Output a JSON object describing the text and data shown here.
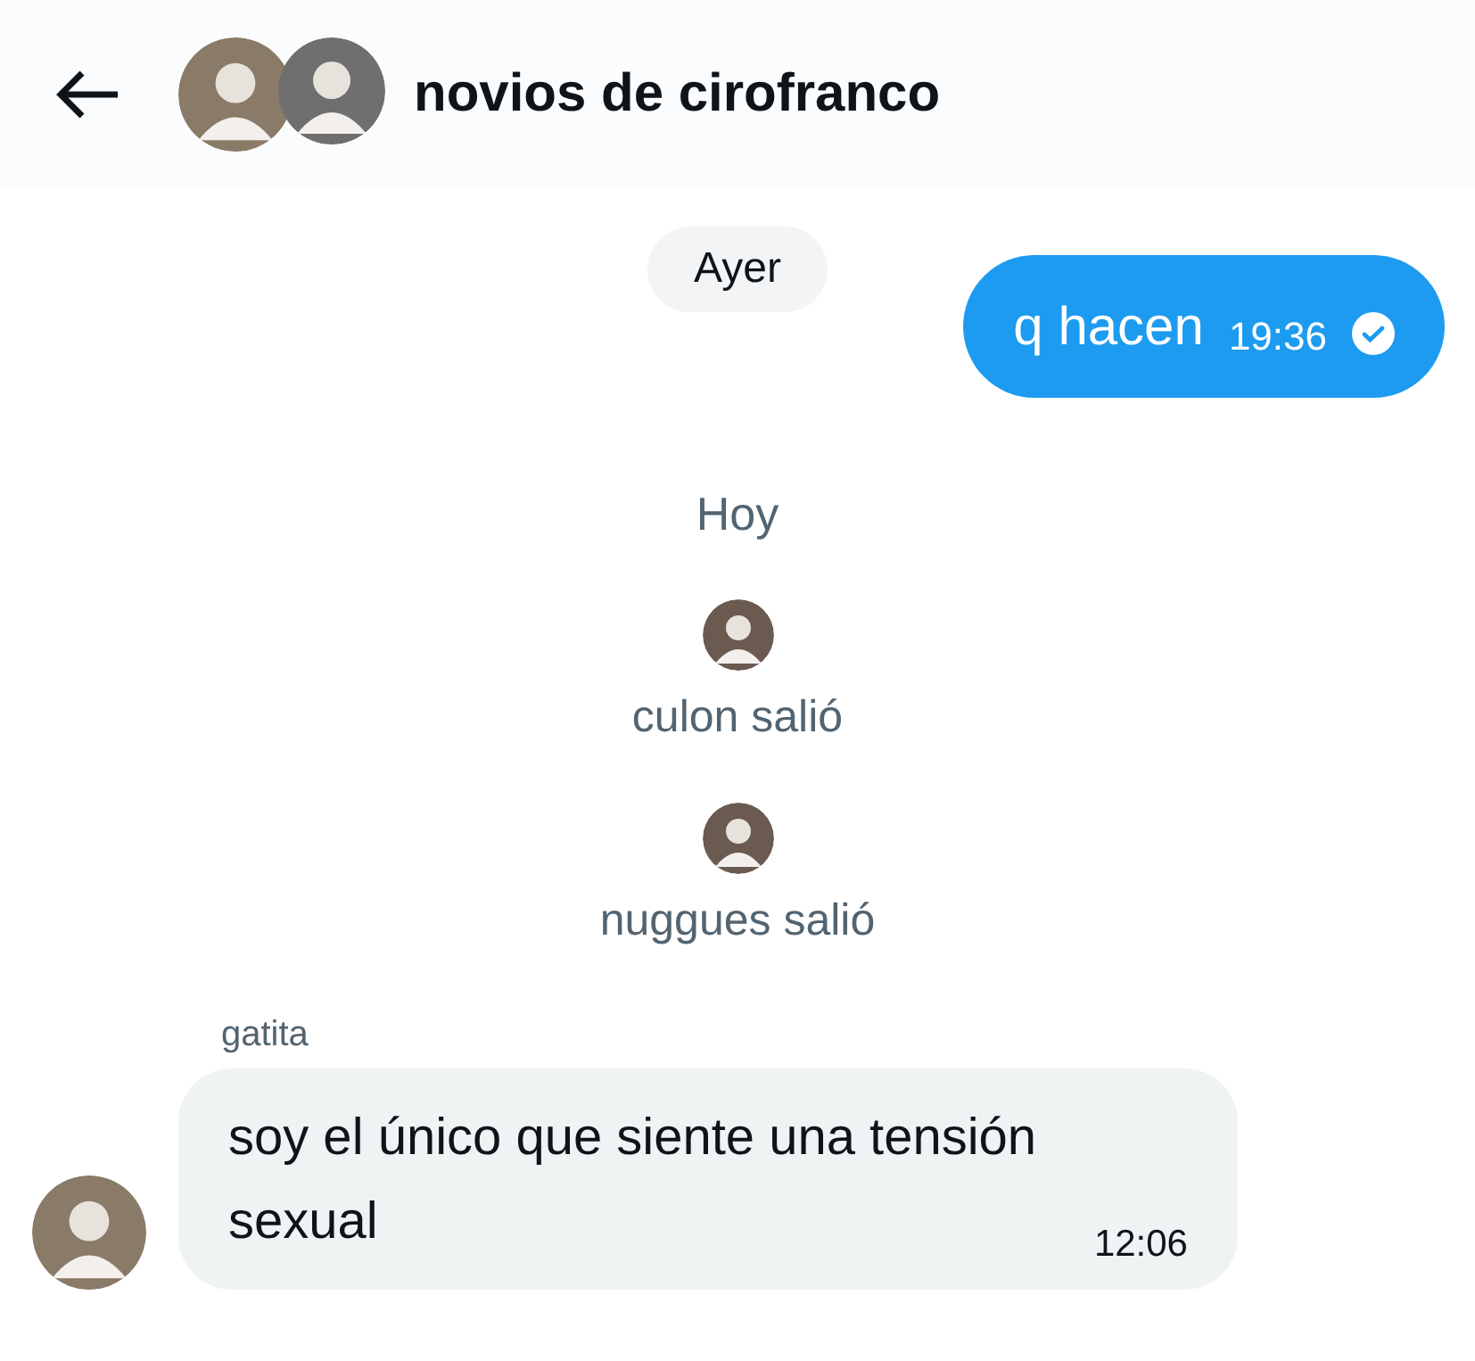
{
  "header": {
    "title": "novios de cirofranco"
  },
  "messages": [
    {
      "kind": "date",
      "text": "Ayer"
    },
    {
      "kind": "outgoing",
      "text": "q hacen",
      "time": "19:36",
      "read": true
    },
    {
      "kind": "date_plain",
      "text": "Hoy"
    },
    {
      "kind": "system",
      "text": "culon salió"
    },
    {
      "kind": "system",
      "text": "nuggues salió"
    },
    {
      "kind": "incoming",
      "sender": "gatita",
      "text": "soy el único que siente una tensión sexual",
      "time": "12:06"
    }
  ]
}
